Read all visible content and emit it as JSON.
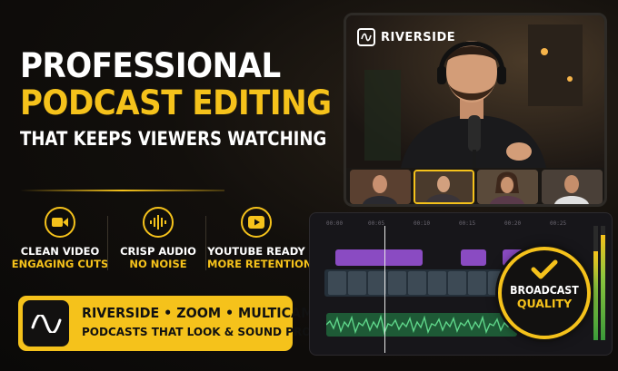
{
  "headline": {
    "line1": "PROFESSIONAL",
    "line2": "PODCAST EDITING",
    "line3": "THAT KEEPS VIEWERS WATCHING"
  },
  "features": [
    {
      "icon": "video-camera-icon",
      "title": "CLEAN VIDEO",
      "subtitle": "ENGAGING CUTS"
    },
    {
      "icon": "audio-waveform-icon",
      "title": "CRISP AUDIO",
      "subtitle": "NO NOISE"
    },
    {
      "icon": "play-button-icon",
      "title": "YOUTUBE READY",
      "subtitle": "MORE RETENTION"
    }
  ],
  "banner": {
    "icon": "sine-wave-icon",
    "line1": "RIVERSIDE • ZOOM • MULTICAM",
    "line2": "PODCASTS THAT LOOK & SOUND PRO"
  },
  "tablet": {
    "brand": "RIVERSIDE",
    "thumbnails": [
      "host-thumbnail",
      "guest-thumbnail-1",
      "guest-thumbnail-2",
      "guest-thumbnail-3"
    ]
  },
  "editor": {
    "ruler_ticks": [
      "00:00",
      "00:05",
      "00:10",
      "00:15",
      "00:20",
      "00:25"
    ]
  },
  "badge": {
    "line1": "BROADCAST",
    "line2": "QUALITY"
  },
  "colors": {
    "accent": "#f5c21b",
    "background": "#0a0908",
    "purple_track": "#8a4bc2",
    "audio_track": "#1e5a36"
  }
}
